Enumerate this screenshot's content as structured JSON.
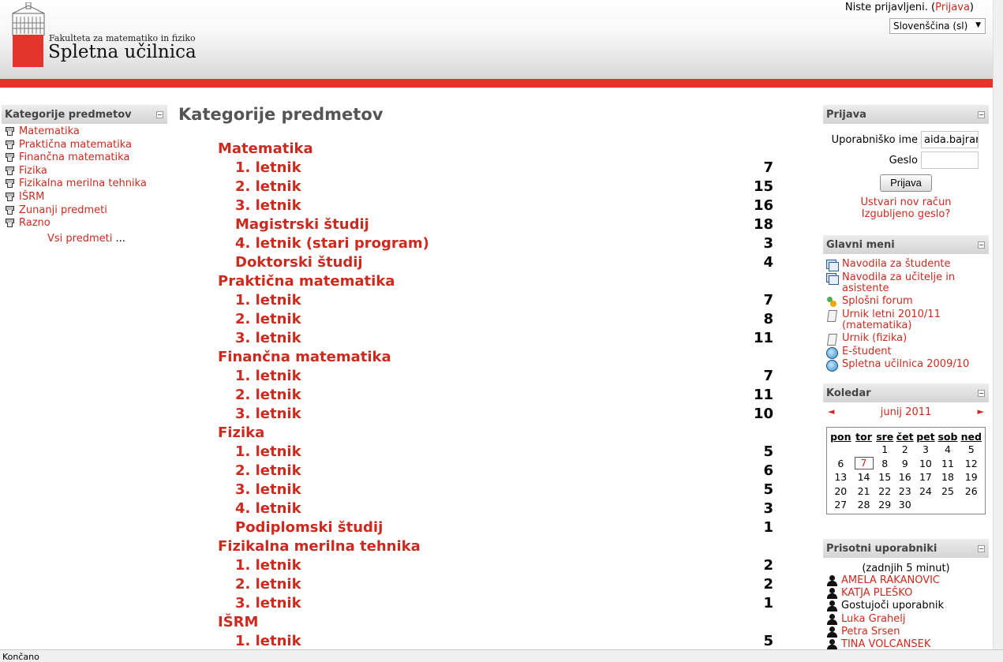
{
  "header": {
    "faculty": "Fakulteta za matematiko in fiziko",
    "site_name": "Spletna učilnica",
    "not_logged_in": "Niste prijavljeni.",
    "login_link": "Prijava",
    "language": "Slovenščina (sl)"
  },
  "left_block": {
    "title": "Kategorije predmetov",
    "items": [
      "Matematika",
      "Praktična matematika",
      "Finančna matematika",
      "Fizika",
      "Fizikalna merilna tehnika",
      "IŠRM",
      "Zunanji predmeti",
      "Razno"
    ],
    "all_courses": "Vsi predmeti",
    "ellipsis": "..."
  },
  "main": {
    "title": "Kategorije predmetov",
    "rows": [
      {
        "name": "Matematika",
        "count": "",
        "level": 0
      },
      {
        "name": "1. letnik",
        "count": "7",
        "level": 1
      },
      {
        "name": "2. letnik",
        "count": "15",
        "level": 1
      },
      {
        "name": "3. letnik",
        "count": "16",
        "level": 1
      },
      {
        "name": "Magistrski študij",
        "count": "18",
        "level": 1
      },
      {
        "name": "4. letnik (stari program)",
        "count": "3",
        "level": 1
      },
      {
        "name": "Doktorski študij",
        "count": "4",
        "level": 1
      },
      {
        "name": "Praktična matematika",
        "count": "",
        "level": 0
      },
      {
        "name": "1. letnik",
        "count": "7",
        "level": 1
      },
      {
        "name": "2. letnik",
        "count": "8",
        "level": 1
      },
      {
        "name": "3. letnik",
        "count": "11",
        "level": 1
      },
      {
        "name": "Finančna matematika",
        "count": "",
        "level": 0
      },
      {
        "name": "1. letnik",
        "count": "7",
        "level": 1
      },
      {
        "name": "2. letnik",
        "count": "11",
        "level": 1
      },
      {
        "name": "3. letnik",
        "count": "10",
        "level": 1
      },
      {
        "name": "Fizika",
        "count": "",
        "level": 0
      },
      {
        "name": "1. letnik",
        "count": "5",
        "level": 1
      },
      {
        "name": "2. letnik",
        "count": "6",
        "level": 1
      },
      {
        "name": "3. letnik",
        "count": "5",
        "level": 1
      },
      {
        "name": "4. letnik",
        "count": "3",
        "level": 1
      },
      {
        "name": "Podiplomski študij",
        "count": "1",
        "level": 1
      },
      {
        "name": "Fizikalna merilna tehnika",
        "count": "",
        "level": 0
      },
      {
        "name": "1. letnik",
        "count": "2",
        "level": 1
      },
      {
        "name": "2. letnik",
        "count": "2",
        "level": 1
      },
      {
        "name": "3. letnik",
        "count": "1",
        "level": 1
      },
      {
        "name": "IŠRM",
        "count": "",
        "level": 0
      },
      {
        "name": "1. letnik",
        "count": "5",
        "level": 1
      }
    ]
  },
  "login_block": {
    "title": "Prijava",
    "username_label": "Uporabniško ime",
    "username_value": "aida.bajrar",
    "password_label": "Geslo",
    "password_value": "",
    "submit": "Prijava",
    "create_account": "Ustvari nov račun",
    "forgot_password": "Izgubljeno geslo?"
  },
  "main_menu": {
    "title": "Glavni meni",
    "items": [
      {
        "label": "Navodila za študente",
        "icon": "document-icon"
      },
      {
        "label": "Navodila za učitelje in asistente",
        "icon": "document-icon"
      },
      {
        "label": "Splošni forum",
        "icon": "forum-icon"
      },
      {
        "label": "Urnik letni 2010/11 (matematika)",
        "icon": "page-icon"
      },
      {
        "label": "Urnik (fizika)",
        "icon": "page-icon"
      },
      {
        "label": "E-študent",
        "icon": "globe-icon"
      },
      {
        "label": "Spletna učilnica 2009/10",
        "icon": "globe-icon"
      }
    ]
  },
  "calendar": {
    "title": "Koledar",
    "month": "junij 2011",
    "prev": "◄",
    "next": "►",
    "weekdays": [
      "pon",
      "tor",
      "sre",
      "čet",
      "pet",
      "sob",
      "ned"
    ],
    "weeks": [
      [
        "",
        "",
        "1",
        "2",
        "3",
        "4",
        "5"
      ],
      [
        "6",
        "7",
        "8",
        "9",
        "10",
        "11",
        "12"
      ],
      [
        "13",
        "14",
        "15",
        "16",
        "17",
        "18",
        "19"
      ],
      [
        "20",
        "21",
        "22",
        "23",
        "24",
        "25",
        "26"
      ],
      [
        "27",
        "28",
        "29",
        "30",
        "",
        "",
        ""
      ]
    ],
    "today": "7"
  },
  "online_users": {
    "title": "Prisotni uporabniki",
    "note": "(zadnjih 5 minut)",
    "users": [
      {
        "name": "AMELA RAKANOVIC",
        "link": true
      },
      {
        "name": "KATJA PLEŠKO",
        "link": true
      },
      {
        "name": "Gostujoči uporabnik",
        "link": false
      },
      {
        "name": "Luka Grahelj",
        "link": true
      },
      {
        "name": "Petra Srsen",
        "link": true
      },
      {
        "name": "TINA VOLCANSEK",
        "link": true
      }
    ]
  },
  "status_bar": "Končano",
  "colors": {
    "accent": "#cc2a1f",
    "brand_red": "#e3332a"
  }
}
